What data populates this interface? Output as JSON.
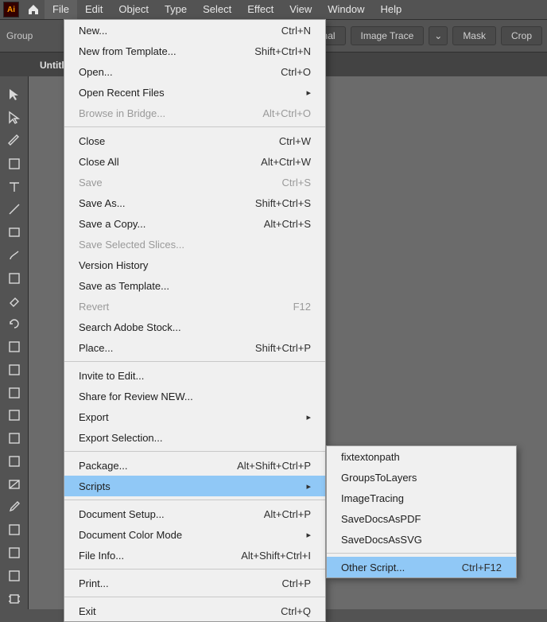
{
  "app_badge": "Ai",
  "menubar": [
    "File",
    "Edit",
    "Object",
    "Type",
    "Select",
    "Effect",
    "View",
    "Window",
    "Help"
  ],
  "active_menu_index": 0,
  "controlbar": {
    "group_label": "Group",
    "original_btn": "Original",
    "image_trace_btn": "Image Trace",
    "mask_btn": "Mask",
    "crop_btn": "Crop"
  },
  "tab_title": "Untitl",
  "file_menu": {
    "groups": [
      [
        {
          "label": "New...",
          "shortcut": "Ctrl+N"
        },
        {
          "label": "New from Template...",
          "shortcut": "Shift+Ctrl+N"
        },
        {
          "label": "Open...",
          "shortcut": "Ctrl+O"
        },
        {
          "label": "Open Recent Files",
          "submenu": true
        },
        {
          "label": "Browse in Bridge...",
          "shortcut": "Alt+Ctrl+O",
          "disabled": true
        }
      ],
      [
        {
          "label": "Close",
          "shortcut": "Ctrl+W"
        },
        {
          "label": "Close All",
          "shortcut": "Alt+Ctrl+W"
        },
        {
          "label": "Save",
          "shortcut": "Ctrl+S",
          "disabled": true
        },
        {
          "label": "Save As...",
          "shortcut": "Shift+Ctrl+S"
        },
        {
          "label": "Save a Copy...",
          "shortcut": "Alt+Ctrl+S"
        },
        {
          "label": "Save Selected Slices...",
          "disabled": true
        },
        {
          "label": "Version History"
        },
        {
          "label": "Save as Template..."
        },
        {
          "label": "Revert",
          "shortcut": "F12",
          "disabled": true
        },
        {
          "label": "Search Adobe Stock..."
        },
        {
          "label": "Place...",
          "shortcut": "Shift+Ctrl+P"
        }
      ],
      [
        {
          "label": "Invite to Edit..."
        },
        {
          "label": "Share for Review NEW..."
        },
        {
          "label": "Export",
          "submenu": true
        },
        {
          "label": "Export Selection..."
        }
      ],
      [
        {
          "label": "Package...",
          "shortcut": "Alt+Shift+Ctrl+P"
        },
        {
          "label": "Scripts",
          "submenu": true,
          "highlight": true
        }
      ],
      [
        {
          "label": "Document Setup...",
          "shortcut": "Alt+Ctrl+P"
        },
        {
          "label": "Document Color Mode",
          "submenu": true
        },
        {
          "label": "File Info...",
          "shortcut": "Alt+Shift+Ctrl+I"
        }
      ],
      [
        {
          "label": "Print...",
          "shortcut": "Ctrl+P"
        }
      ],
      [
        {
          "label": "Exit",
          "shortcut": "Ctrl+Q"
        }
      ]
    ]
  },
  "scripts_menu": {
    "groups": [
      [
        {
          "label": "fixtextonpath"
        },
        {
          "label": "GroupsToLayers"
        },
        {
          "label": "ImageTracing"
        },
        {
          "label": "SaveDocsAsPDF"
        },
        {
          "label": "SaveDocsAsSVG"
        }
      ],
      [
        {
          "label": "Other Script...",
          "shortcut": "Ctrl+F12",
          "highlight": true
        }
      ]
    ]
  },
  "tool_icons": [
    "selection",
    "direct-selection",
    "pen",
    "curvature",
    "type",
    "line",
    "rectangle",
    "brush",
    "shaper",
    "eraser",
    "rotate",
    "scale",
    "width",
    "free-transform",
    "shape-builder",
    "perspective",
    "mesh",
    "gradient",
    "eyedropper",
    "blend",
    "symbol-sprayer",
    "column-graph",
    "artboard"
  ]
}
